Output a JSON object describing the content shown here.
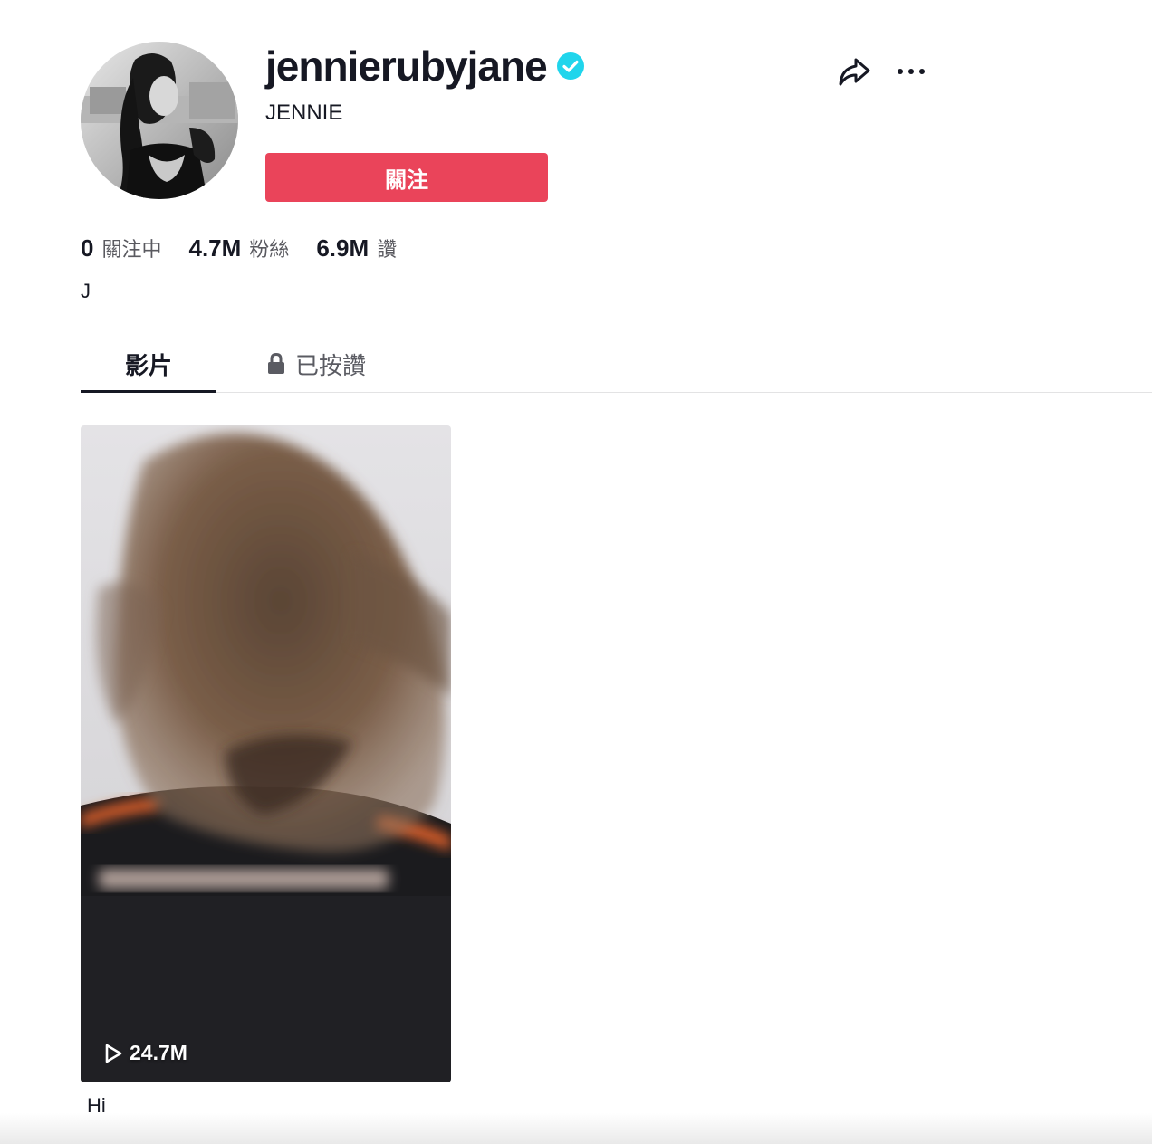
{
  "profile": {
    "username": "jennierubyjane",
    "nickname": "JENNIE",
    "verified": true,
    "verified_color": "#20d5ec",
    "follow_label": "關注",
    "follow_color": "#ea445a",
    "bio": "J"
  },
  "header_actions": {
    "share_icon": "share-arrow-icon",
    "more_icon": "more-horizontal-icon"
  },
  "stats": [
    {
      "value": "0",
      "label": "關注中"
    },
    {
      "value": "4.7M",
      "label": "粉絲"
    },
    {
      "value": "6.9M",
      "label": "讚"
    }
  ],
  "tabs": [
    {
      "label": "影片",
      "active": true
    },
    {
      "label": "已按讚",
      "icon": "lock-icon",
      "active": false
    }
  ],
  "videos": [
    {
      "play_count": "24.7M",
      "caption": "Hi"
    }
  ]
}
